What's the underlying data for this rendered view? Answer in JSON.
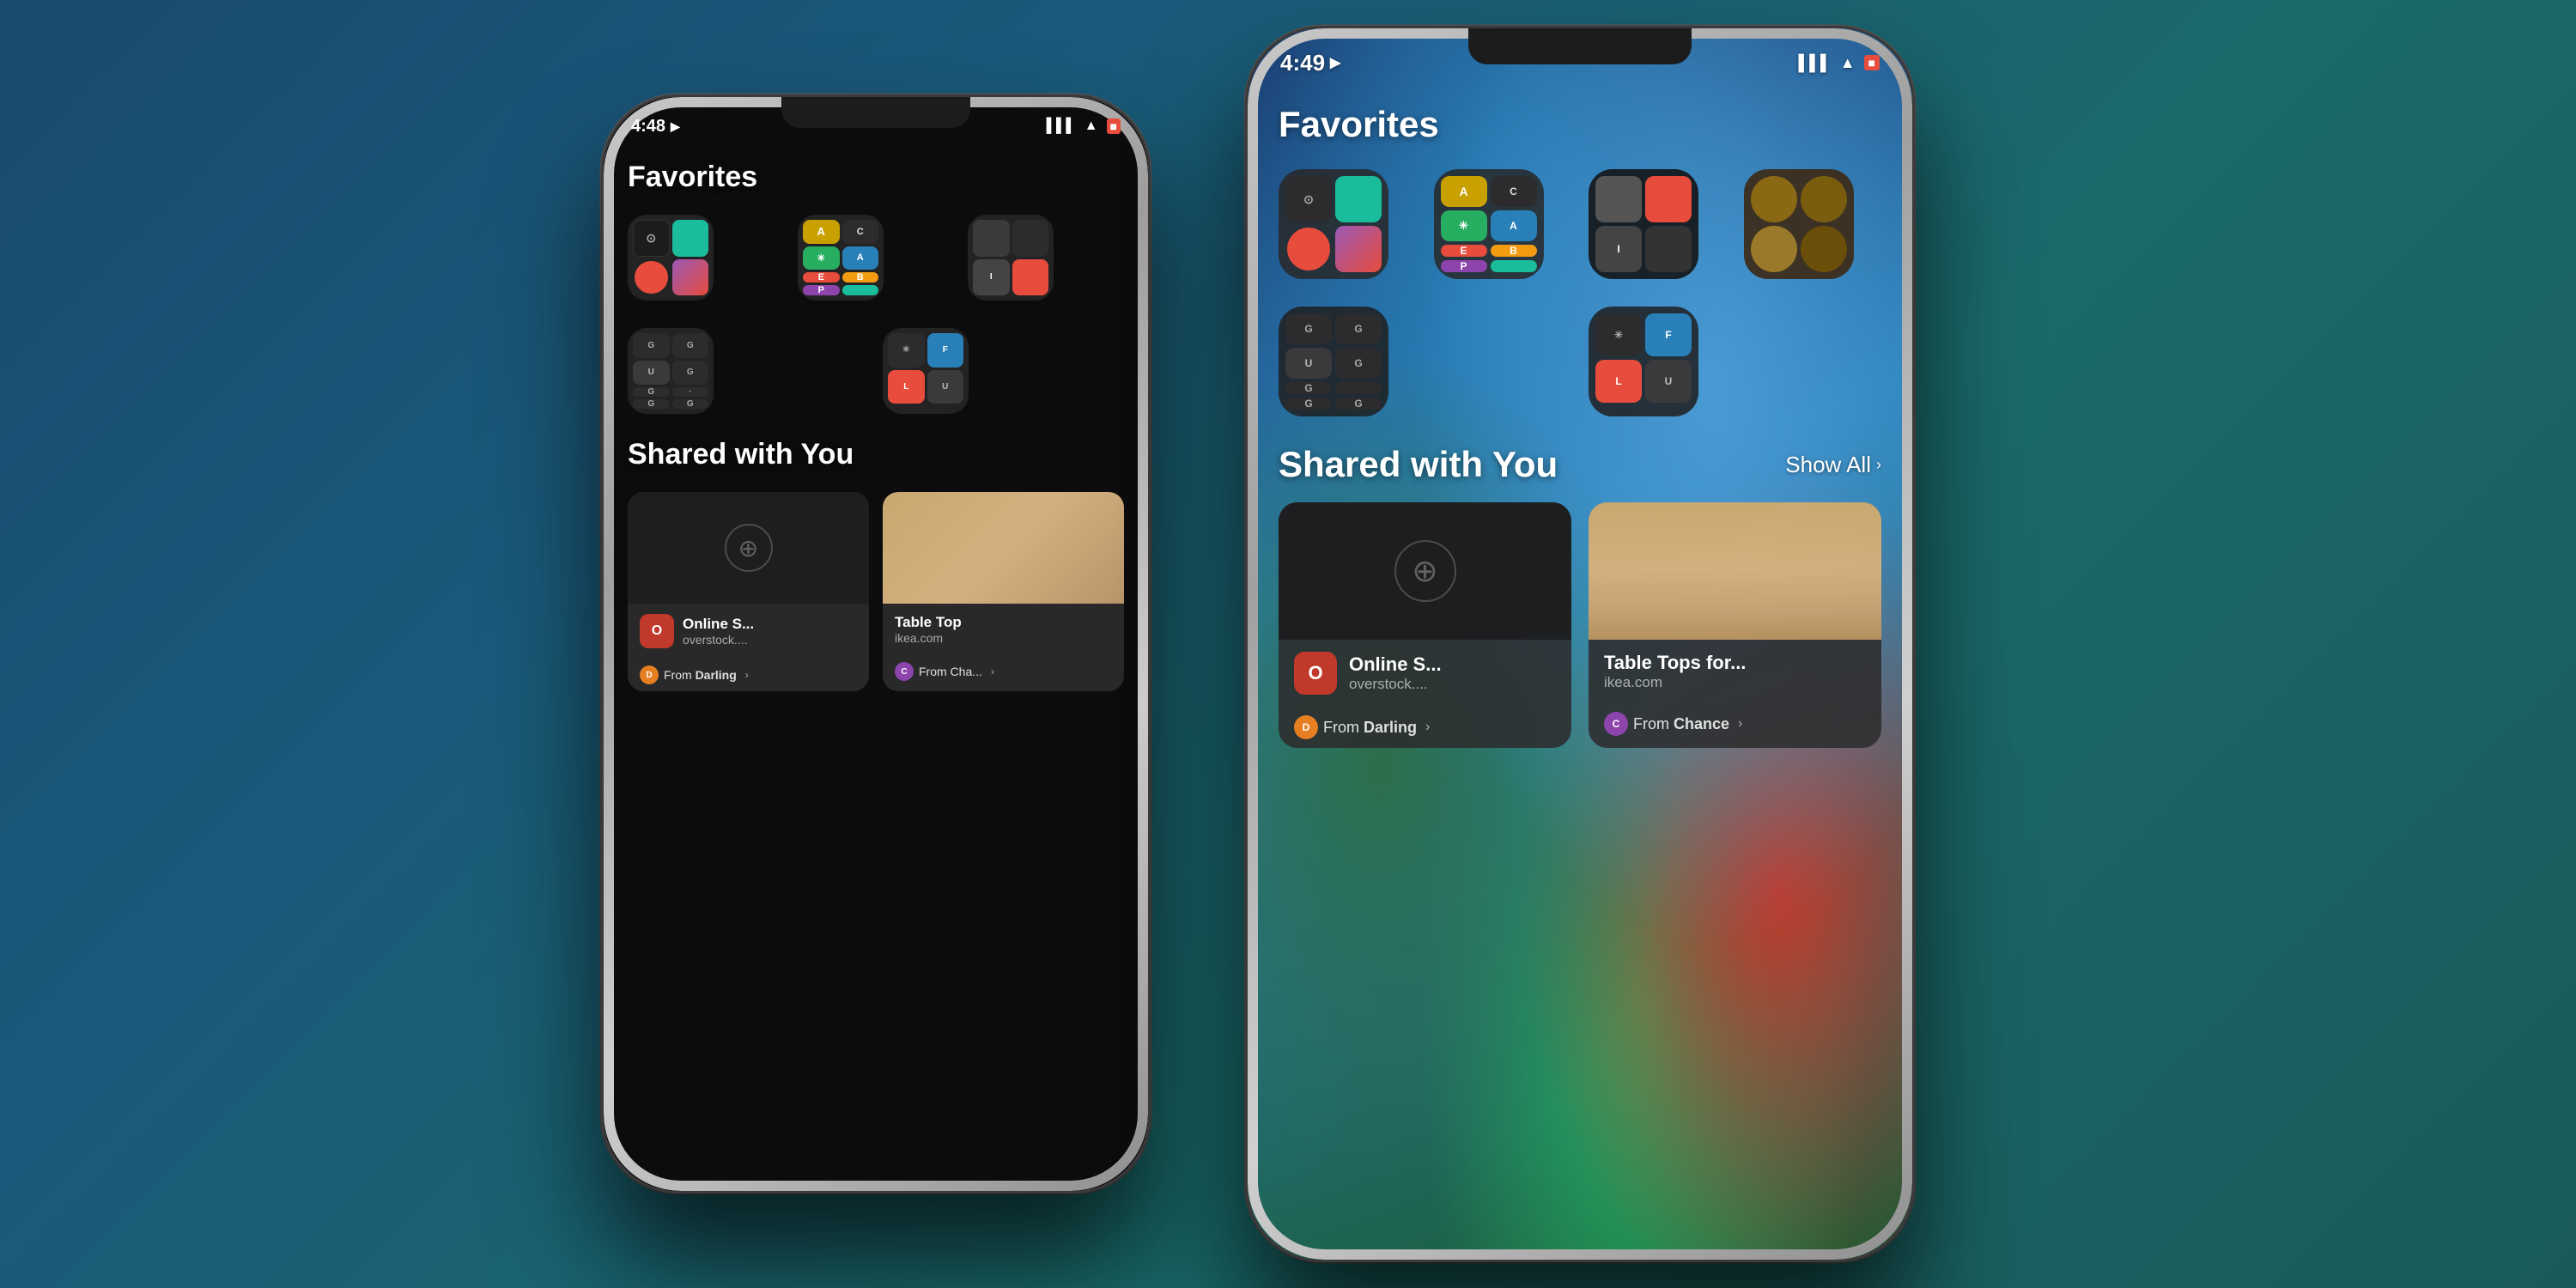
{
  "background": {
    "gradient": "linear-gradient(135deg, #1a4a6e, #1a5a7a, #1a6a6a, #1a5a5a)"
  },
  "phone_back": {
    "time": "4:48",
    "location_icon": "▶",
    "status_icons": "●●● ▲ 🔋",
    "screen": "dark",
    "sections": [
      {
        "id": "favorites",
        "title": "Favorites",
        "folders_row1": [
          {
            "id": "f1",
            "apps": [
              "⊙",
              "©",
              "☮",
              "📊"
            ]
          },
          {
            "id": "f2",
            "apps": [
              "A",
              "✳",
              "E",
              "B"
            ]
          },
          {
            "id": "f3",
            "apps": [
              "·",
              "·",
              "I",
              "·"
            ]
          }
        ],
        "folders_row2": [
          {
            "id": "f4",
            "apps": [
              "G",
              "G",
              "G",
              "G"
            ]
          },
          {
            "id": "f5",
            "apps": [
              "✳",
              "F",
              "L",
              "U"
            ]
          }
        ]
      },
      {
        "id": "shared",
        "title": "Shared with You",
        "cards": [
          {
            "id": "c1",
            "image_type": "dark",
            "app_icon_color": "#c0392b",
            "app_icon_letter": "O",
            "title": "Online S...",
            "subtitle": "overstock....",
            "from_label": "From Darling",
            "from_avatar_color": "#e67e22",
            "from_avatar_letter": "D"
          },
          {
            "id": "c2",
            "image_type": "wood",
            "app_icon_color": "#636366",
            "app_icon_letter": "",
            "title": "Table Top",
            "subtitle": "ikea.com",
            "from_label": "From Cha...",
            "from_avatar_color": "#8e44ad",
            "from_avatar_letter": "C"
          }
        ]
      }
    ]
  },
  "phone_front": {
    "time": "4:49",
    "location_icon": "▶",
    "status_signal": "▌▌▌",
    "status_wifi": "▲",
    "status_battery": "🔋",
    "screen": "colorful",
    "sections": [
      {
        "id": "favorites",
        "title": "Favorites",
        "folders_row1": [
          {
            "id": "f1",
            "apps": [
              "⊙",
              "©",
              "☮",
              "📊"
            ]
          },
          {
            "id": "f2",
            "apps": [
              "A",
              "✳",
              "E",
              "B"
            ]
          },
          {
            "id": "f3",
            "apps": [
              "·",
              "·",
              "I",
              "·"
            ]
          },
          {
            "id": "f4",
            "apps": [
              "⊙",
              "⊙",
              "⊙",
              "⊙"
            ]
          }
        ],
        "folders_row2": [
          {
            "id": "f5",
            "apps": [
              "G",
              "G",
              "G",
              "G"
            ]
          },
          {
            "id": "f6",
            "apps": [
              "✳",
              "F",
              "L",
              "U"
            ]
          }
        ]
      },
      {
        "id": "shared",
        "title": "Shared with You",
        "show_all_label": "Show All",
        "cards": [
          {
            "id": "sc1",
            "image_type": "dark",
            "app_icon_color": "#c0392b",
            "app_icon_letter": "O",
            "title": "Online S...",
            "subtitle": "overstock....",
            "from_label": "From Darling",
            "from_avatar_color": "#e67e22",
            "from_avatar_letter": "D",
            "from_bold": "Darling"
          },
          {
            "id": "sc2",
            "image_type": "wood",
            "app_icon_color": "#636366",
            "app_icon_letter": "",
            "title": "Table Tops for...",
            "subtitle": "ikea.com",
            "from_label": "From Chance",
            "from_avatar_color": "#8e44ad",
            "from_avatar_letter": "C",
            "from_bold": "Chance"
          }
        ]
      }
    ]
  }
}
